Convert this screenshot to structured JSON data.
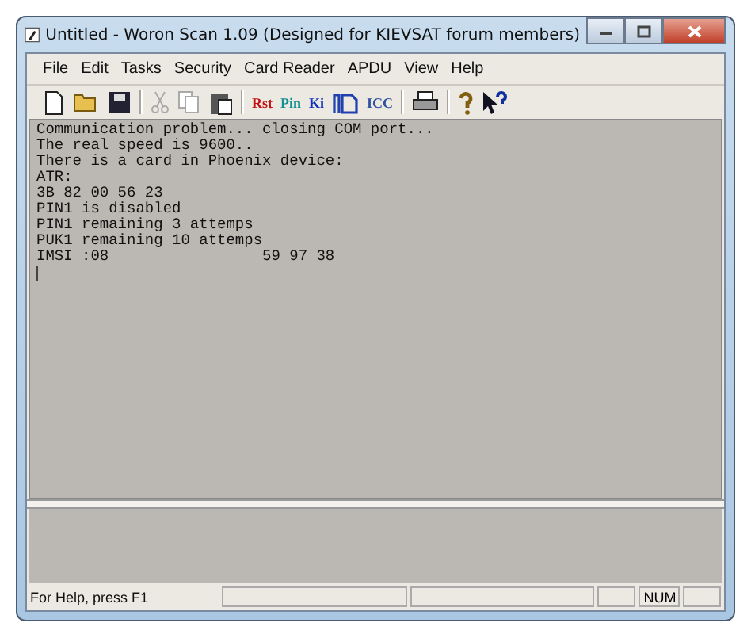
{
  "window": {
    "title": "Untitled - Woron Scan 1.09 (Designed for KIEVSAT forum members)"
  },
  "menu": [
    "File",
    "Edit",
    "Tasks",
    "Security",
    "Card Reader",
    "APDU",
    "View",
    "Help"
  ],
  "toolbar": [
    {
      "kind": "new"
    },
    {
      "kind": "open"
    },
    {
      "kind": "save"
    },
    {
      "kind": "sep"
    },
    {
      "kind": "cut",
      "disabled": true
    },
    {
      "kind": "copy",
      "disabled": true
    },
    {
      "kind": "paste",
      "disabled": false
    },
    {
      "kind": "sep"
    },
    {
      "kind": "text",
      "label": "Rst",
      "color": "#c01010"
    },
    {
      "kind": "text",
      "label": "Pin",
      "color": "#109090"
    },
    {
      "kind": "text",
      "label": "Ki",
      "color": "#1030c0"
    },
    {
      "kind": "imsi"
    },
    {
      "kind": "text",
      "label": "ICC",
      "color": "#3050a0"
    },
    {
      "kind": "sep"
    },
    {
      "kind": "print"
    },
    {
      "kind": "sep"
    },
    {
      "kind": "help"
    },
    {
      "kind": "whatsthis"
    }
  ],
  "log": [
    "Communication problem... closing COM port...",
    "The real speed is 9600..",
    "There is a card in Phoenix device:",
    "ATR:",
    "3B 82 00 56 23",
    "PIN1 is disabled",
    "PIN1 remaining 3 attemps",
    "PUK1 remaining 10 attemps",
    "IMSI :08                 59 97 38"
  ],
  "status_bar": {
    "message": "For Help, press F1",
    "num": "NUM"
  }
}
